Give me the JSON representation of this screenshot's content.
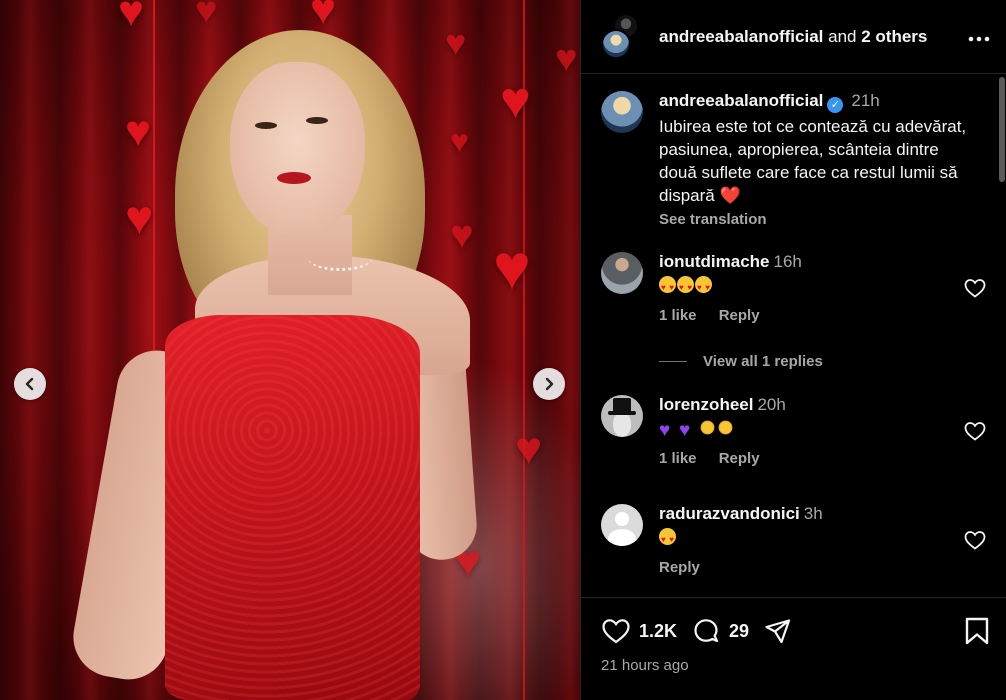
{
  "header": {
    "username": "andreeabalanofficial",
    "connector": "and",
    "others": "2 others"
  },
  "caption": {
    "username": "andreeabalanofficial",
    "time": "21h",
    "text": "Iubirea este tot ce contează cu adevărat, pasiunea, apropierea, scânteia dintre două suflete care face ca restul lumii să dispară ❤️",
    "see_translation": "See translation"
  },
  "comments": [
    {
      "username": "ionutdimache",
      "time": "16h",
      "emojis": [
        "heart-eyes",
        "heart-eyes",
        "heart-eyes"
      ],
      "likes": "1 like",
      "reply": "Reply"
    },
    {
      "username": "lorenzoheel",
      "time": "20h",
      "emojis": [
        "purple-heart",
        "purple-heart",
        "sun",
        "sun"
      ],
      "likes": "1 like",
      "reply": "Reply"
    },
    {
      "username": "radurazvandonici",
      "time": "3h",
      "emojis": [
        "heart-eyes"
      ],
      "likes": "",
      "reply": "Reply"
    }
  ],
  "view_replies": "View all 1 replies",
  "actions": {
    "likes": "1.2K",
    "comments": "29",
    "time_ago": "21 hours ago"
  },
  "icons": {
    "more": "more-options-icon",
    "like": "heart-icon",
    "comment": "comment-icon",
    "share": "share-icon",
    "save": "bookmark-icon",
    "prev": "chevron-left-icon",
    "next": "chevron-right-icon",
    "verified": "verified-badge-icon"
  },
  "colors": {
    "background": "#000000",
    "verified": "#3797f0",
    "muted": "#a8a8a8"
  }
}
